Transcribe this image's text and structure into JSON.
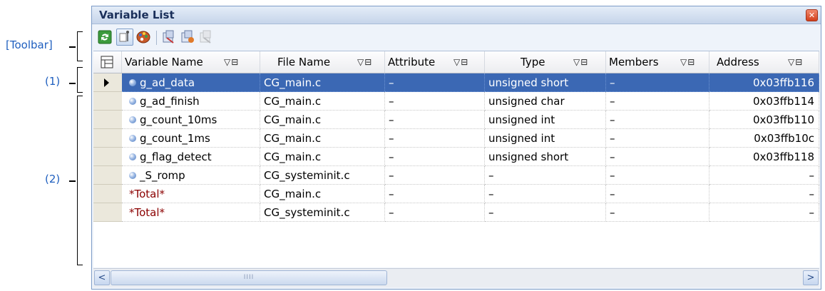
{
  "callouts": {
    "toolbar": "[Toolbar]",
    "header": "(1)",
    "rows": "(2)"
  },
  "window": {
    "title": "Variable List",
    "close_glyph": "✕"
  },
  "toolbar": {
    "buttons": [
      "refresh-icon",
      "pin-icon",
      "palette-icon",
      "variable-icon-1",
      "variable-icon-2",
      "variable-icon-3-disabled"
    ]
  },
  "columns": [
    {
      "label": "Variable Name",
      "filter": "▽⊟"
    },
    {
      "label": "File Name",
      "filter": "▽⊟"
    },
    {
      "label": "Attribute",
      "filter": "▽⊟"
    },
    {
      "label": "Type",
      "filter": "▽⊟"
    },
    {
      "label": "Members",
      "filter": "▽⊟"
    },
    {
      "label": "Address",
      "filter": "▽⊟"
    }
  ],
  "rows": [
    {
      "name": "g_ad_data",
      "file": "CG_main.c",
      "attribute": "–",
      "type": "unsigned short",
      "members": "–",
      "address": "0x03ffb116",
      "selected": true,
      "bullet": true,
      "total": false
    },
    {
      "name": "g_ad_finish",
      "file": "CG_main.c",
      "attribute": "–",
      "type": "unsigned char",
      "members": "–",
      "address": "0x03ffb114",
      "selected": false,
      "bullet": true,
      "total": false
    },
    {
      "name": "g_count_10ms",
      "file": "CG_main.c",
      "attribute": "–",
      "type": "unsigned int",
      "members": "–",
      "address": "0x03ffb110",
      "selected": false,
      "bullet": true,
      "total": false
    },
    {
      "name": "g_count_1ms",
      "file": "CG_main.c",
      "attribute": "–",
      "type": "unsigned int",
      "members": "–",
      "address": "0x03ffb10c",
      "selected": false,
      "bullet": true,
      "total": false
    },
    {
      "name": "g_flag_detect",
      "file": "CG_main.c",
      "attribute": "–",
      "type": "unsigned short",
      "members": "–",
      "address": "0x03ffb118",
      "selected": false,
      "bullet": true,
      "total": false
    },
    {
      "name": "_S_romp",
      "file": "CG_systeminit.c",
      "attribute": "–",
      "type": "–",
      "members": "–",
      "address": "–",
      "selected": false,
      "bullet": true,
      "total": false
    },
    {
      "name": "*Total*",
      "file": "CG_main.c",
      "attribute": "–",
      "type": "–",
      "members": "–",
      "address": "–",
      "selected": false,
      "bullet": false,
      "total": true
    },
    {
      "name": "*Total*",
      "file": "CG_systeminit.c",
      "attribute": "–",
      "type": "–",
      "members": "–",
      "address": "–",
      "selected": false,
      "bullet": false,
      "total": true
    }
  ],
  "scrollbar": {
    "left_arrow": "<",
    "right_arrow": ">",
    "thumb_grip": "IIII"
  }
}
